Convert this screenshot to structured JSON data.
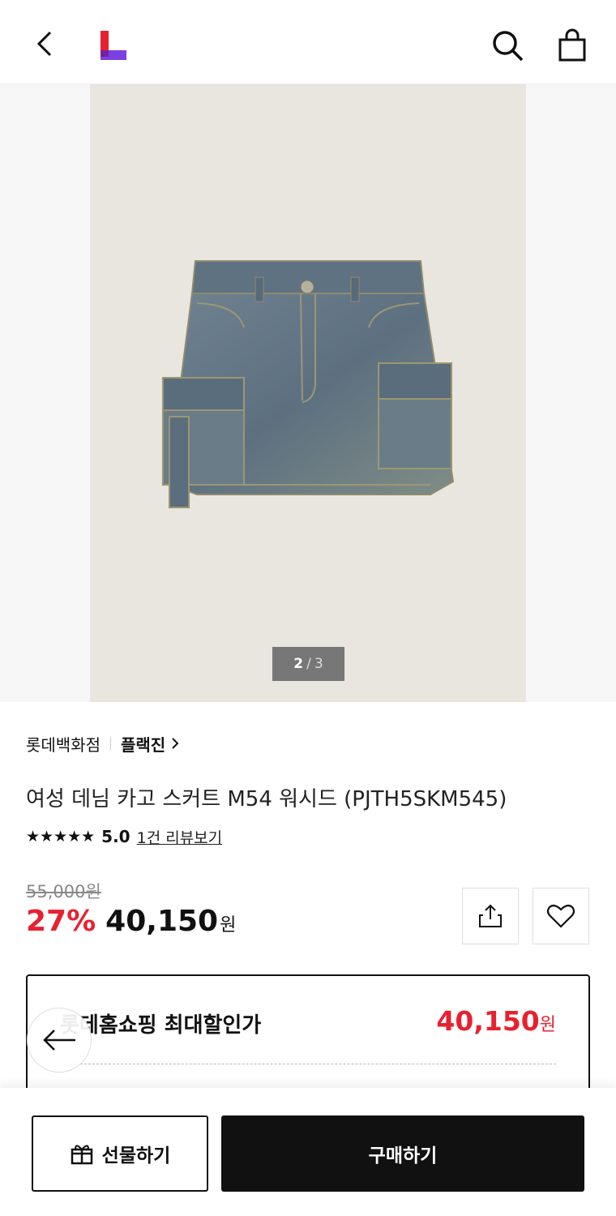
{
  "header": {
    "back_icon": "chevron-left-icon",
    "logo_icon": "lotte-l-logo",
    "search_icon": "search-icon",
    "bag_icon": "shopping-bag-icon",
    "logo_colors": [
      "#e8212f",
      "#7b3fe4"
    ]
  },
  "gallery": {
    "current": "2",
    "separator": "/",
    "total": "3"
  },
  "product": {
    "store": "롯데백화점",
    "brand": "플랙진",
    "title": "여성 데님 카고 스커트 M54 워시드 (PJTH5SKM545)",
    "stars": "★★★★★",
    "rating": "5.0",
    "review_link": "1건 리뷰보기",
    "original_price": "55,000원",
    "discount": "27%",
    "price": "40,150",
    "currency": "원"
  },
  "actions": {
    "share_icon": "share-icon",
    "wish_icon": "heart-icon"
  },
  "best_price": {
    "label": "롯데홈쇼핑 최대할인가",
    "amount": "40,150",
    "currency": "원"
  },
  "bottom": {
    "gift_label": "선물하기",
    "buy_label": "구매하기",
    "gift_icon": "gift-icon"
  },
  "colors": {
    "accent_red": "#e8212f",
    "dark": "#111111"
  }
}
